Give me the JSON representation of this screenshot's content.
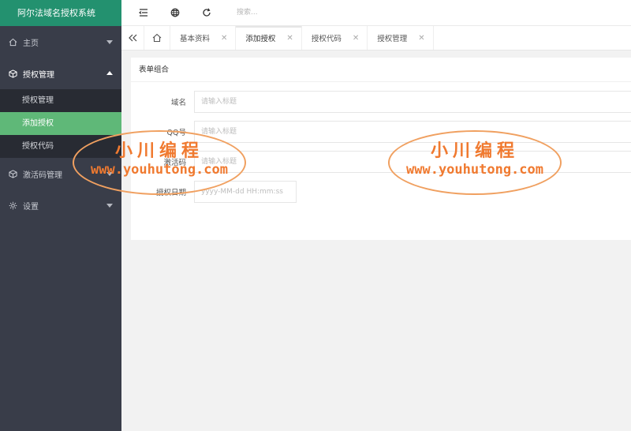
{
  "app": {
    "title": "阿尔法域名授权系统"
  },
  "header": {
    "search_placeholder": "搜索..."
  },
  "sidebar": {
    "items": [
      {
        "label": "主页"
      },
      {
        "label": "授权管理",
        "children": [
          "授权管理",
          "添加授权",
          "授权代码"
        ]
      },
      {
        "label": "激活码管理"
      },
      {
        "label": "设置"
      }
    ]
  },
  "tabs": [
    "基本资料",
    "添加授权",
    "授权代码",
    "授权管理"
  ],
  "card": {
    "title": "表单组合",
    "fields": [
      {
        "label": "域名",
        "placeholder": "请输入标题"
      },
      {
        "label": "QQ号",
        "placeholder": "请输入标题"
      },
      {
        "label": "激活码",
        "placeholder": "请输入标题"
      },
      {
        "label": "授权日期",
        "placeholder": "yyyy-MM-dd HH:mm:ss"
      }
    ]
  },
  "watermark": {
    "title": "小川编程",
    "url": "www.youhutong.com"
  },
  "colors": {
    "sidebar": "#393d49",
    "logo": "#23916f",
    "active": "#5fb878",
    "watermark": "#f07a30"
  }
}
